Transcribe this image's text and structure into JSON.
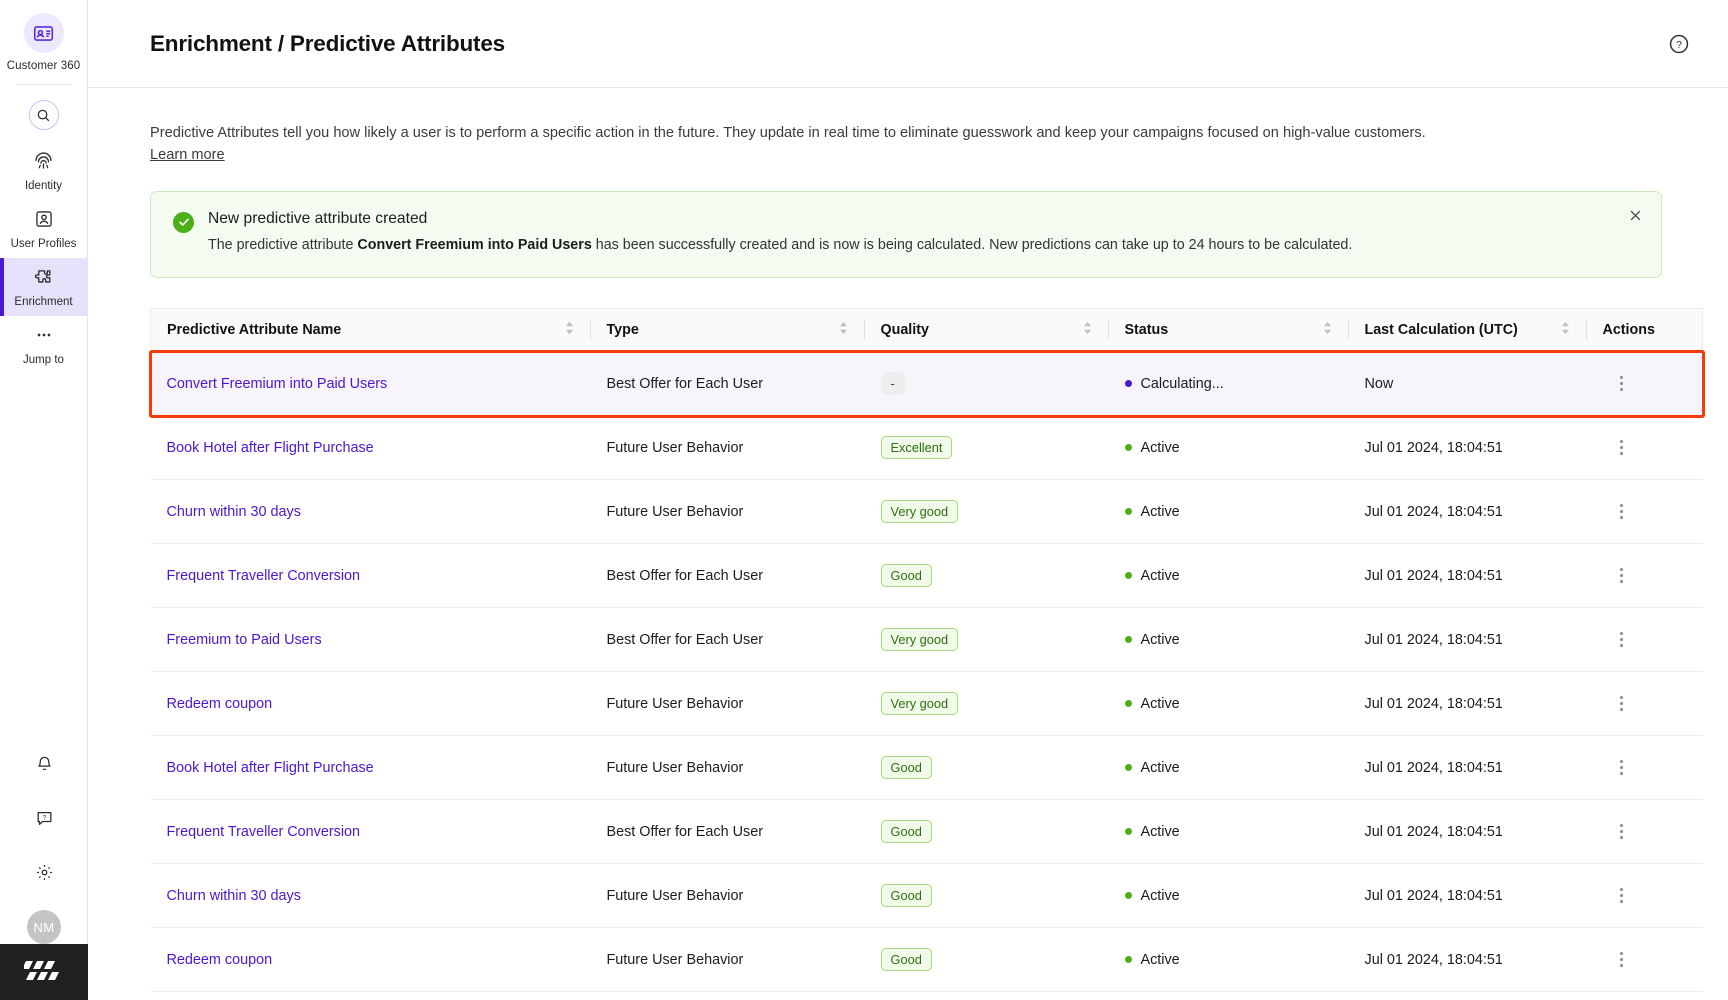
{
  "sidebar": {
    "brand": {
      "label": "Customer 360",
      "icon": "contact-card-icon"
    },
    "search": {
      "icon": "search-icon"
    },
    "items": [
      {
        "label": "Identity",
        "icon": "fingerprint-icon",
        "active": false
      },
      {
        "label": "User Profiles",
        "icon": "user-profile-icon",
        "active": false
      },
      {
        "label": "Enrichment",
        "icon": "puzzle-piece-icon",
        "active": true
      },
      {
        "label": "Jump to",
        "icon": "ellipsis-icon",
        "active": false
      }
    ],
    "bottom": [
      {
        "name": "notifications",
        "icon": "bell-icon"
      },
      {
        "name": "support",
        "icon": "help-chat-icon"
      },
      {
        "name": "settings",
        "icon": "gear-icon"
      }
    ],
    "avatar": {
      "initials": "NM"
    },
    "logo": {
      "name": "brand-logo"
    }
  },
  "header": {
    "title": "Enrichment / Predictive Attributes",
    "help_icon": "question-circle-icon"
  },
  "intro": {
    "paragraph": "Predictive Attributes tell you how likely a user is to perform a specific action in the future. They update in real time to eliminate guesswork and keep your campaigns focused on high-value customers.",
    "learn_more": "Learn more"
  },
  "banner": {
    "icon": "check-circle-icon",
    "title": "New predictive attribute created",
    "body_before": "The predictive attribute ",
    "body_bold": "Convert Freemium into Paid Users",
    "body_after": " has been successfully created and is now is being calculated. New predictions can take up to 24 hours to be calculated.",
    "close_icon": "close-icon",
    "bg_color": "#f4fbf0",
    "border_color": "#cfe9bd",
    "accent_color": "#4caf17"
  },
  "table": {
    "columns": [
      {
        "label": "Predictive Attribute Name",
        "sortable": true
      },
      {
        "label": "Type",
        "sortable": true
      },
      {
        "label": "Quality",
        "sortable": true
      },
      {
        "label": "Status",
        "sortable": true
      },
      {
        "label": "Last Calculation (UTC)",
        "sortable": true
      },
      {
        "label": "Actions",
        "sortable": false
      }
    ],
    "rows": [
      {
        "name": "Convert Freemium into Paid Users",
        "type": "Best Offer for Each User",
        "quality": "-",
        "quality_style": "neutral",
        "status": "Calculating...",
        "status_color": "#4b17d3",
        "last_calculation": "Now",
        "highlighted": true
      },
      {
        "name": "Book Hotel after Flight Purchase",
        "type": "Future User Behavior",
        "quality": "Excellent",
        "quality_style": "green",
        "status": "Active",
        "status_color": "#4caf17",
        "last_calculation": "Jul 01 2024, 18:04:51",
        "highlighted": false
      },
      {
        "name": "Churn within 30 days",
        "type": "Future User Behavior",
        "quality": "Very good",
        "quality_style": "green",
        "status": "Active",
        "status_color": "#4caf17",
        "last_calculation": "Jul 01 2024, 18:04:51",
        "highlighted": false
      },
      {
        "name": "Frequent Traveller Conversion",
        "type": "Best Offer for Each User",
        "quality": "Good",
        "quality_style": "green",
        "status": "Active",
        "status_color": "#4caf17",
        "last_calculation": "Jul 01 2024, 18:04:51",
        "highlighted": false
      },
      {
        "name": "Freemium to Paid Users",
        "type": "Best Offer for Each User",
        "quality": "Very good",
        "quality_style": "green",
        "status": "Active",
        "status_color": "#4caf17",
        "last_calculation": "Jul 01 2024, 18:04:51",
        "highlighted": false
      },
      {
        "name": "Redeem coupon",
        "type": "Future User Behavior",
        "quality": "Very good",
        "quality_style": "green",
        "status": "Active",
        "status_color": "#4caf17",
        "last_calculation": "Jul 01 2024, 18:04:51",
        "highlighted": false
      },
      {
        "name": "Book Hotel after Flight Purchase",
        "type": "Future User Behavior",
        "quality": "Good",
        "quality_style": "green",
        "status": "Active",
        "status_color": "#4caf17",
        "last_calculation": "Jul 01 2024, 18:04:51",
        "highlighted": false
      },
      {
        "name": "Frequent Traveller Conversion",
        "type": "Best Offer for Each User",
        "quality": "Good",
        "quality_style": "green",
        "status": "Active",
        "status_color": "#4caf17",
        "last_calculation": "Jul 01 2024, 18:04:51",
        "highlighted": false
      },
      {
        "name": "Churn within 30 days",
        "type": "Future User Behavior",
        "quality": "Good",
        "quality_style": "green",
        "status": "Active",
        "status_color": "#4caf17",
        "last_calculation": "Jul 01 2024, 18:04:51",
        "highlighted": false
      },
      {
        "name": "Redeem coupon",
        "type": "Future User Behavior",
        "quality": "Good",
        "quality_style": "green",
        "status": "Active",
        "status_color": "#4caf17",
        "last_calculation": "Jul 01 2024, 18:04:51",
        "highlighted": false
      }
    ],
    "row_action_icon": "kebab-menu-icon",
    "highlight_border_color": "#f63a08",
    "link_color": "#4b17d3"
  }
}
